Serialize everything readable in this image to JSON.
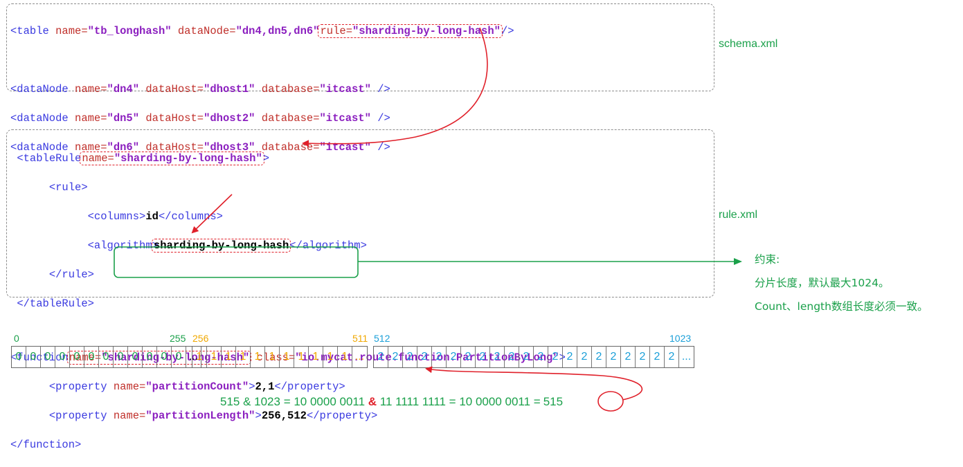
{
  "schema": {
    "table": {
      "tag": "<table",
      "a1": " name=",
      "v1": "\"tb_longhash\"",
      "a2": " dataNode=",
      "v2": "\"dn4,dn5,dn6\"",
      "a3": "rule=",
      "v3": "\"sharding-by-long-hash\"",
      "end": "/>"
    },
    "datanodes": [
      {
        "tag": "<dataNode",
        "a1": " name=",
        "v1": "\"dn4\"",
        "a2": " dataHost=",
        "v2": "\"dhost1\"",
        "a3": " database=",
        "v3": "\"itcast\"",
        "end": " />"
      },
      {
        "tag": "<dataNode",
        "a1": " name=",
        "v1": "\"dn5\"",
        "a2": " dataHost=",
        "v2": "\"dhost2\"",
        "a3": " database=",
        "v3": "\"itcast\"",
        "end": " />"
      },
      {
        "tag": "<dataNode",
        "a1": " name=",
        "v1": "\"dn6\"",
        "a2": " dataHost=",
        "v2": "\"dhost3\"",
        "a3": " database=",
        "v3": "\"itcast\"",
        "end": " />"
      }
    ],
    "file_label": "schema.xml"
  },
  "rule": {
    "tableRule_open": "<tableRule",
    "tableRule_attr": "name=",
    "tableRule_val": "\"sharding-by-long-hash\"",
    "tableRule_gt": ">",
    "rule_open": "<rule>",
    "columns_open": "<columns>",
    "columns_val": "id",
    "columns_close": "</columns>",
    "algorithm_open": "<algorithm>",
    "algorithm_val": "sharding-by-long-hash",
    "algorithm_close": "</algorithm>",
    "rule_close": "</rule>",
    "tableRule_close": "</tableRule>",
    "function_open": "<function",
    "function_attr": "name=",
    "function_val": "\"sharding-by-long-hash\"",
    "function_class_attr": " class=",
    "function_class_val": "\"io.mycat.route.function.PartitionByLong\"",
    "function_gt": ">",
    "prop1_open": "<property",
    "prop1_attr": "name=",
    "prop1_val": "\"partitionCount\"",
    "prop1_gt": ">",
    "prop1_text": "2,1",
    "prop1_close": "</property>",
    "prop2_open": "<property",
    "prop2_attr": "name=",
    "prop2_val": "\"partitionLength\"",
    "prop2_gt": ">",
    "prop2_text": "256,512",
    "prop2_close": "</property>",
    "function_close": "</function>",
    "file_label": "rule.xml"
  },
  "constraints": {
    "title": "约束:",
    "line1": "分片长度，默认最大1024。",
    "line2": "Count、length数组长度必须一致。"
  },
  "partitions": {
    "labels": {
      "l0": "0",
      "l255": "255",
      "l256": "256",
      "l511": "511",
      "l512": "512",
      "l1023": "1023"
    },
    "group1": [
      "0",
      "0",
      "0",
      "0",
      "0",
      "0",
      "0",
      "0",
      "0",
      "0",
      "0",
      "0",
      "..."
    ],
    "group2": [
      "1",
      "1",
      "1",
      "1",
      "1",
      "1",
      "1",
      "1",
      "1",
      "1",
      "1",
      "..."
    ],
    "group3": [
      "2",
      "2",
      "2",
      "2",
      "2",
      "2",
      "2",
      "2",
      "2",
      "2",
      "2",
      "2",
      "2",
      "2",
      "2",
      "2",
      "2",
      "2",
      "2",
      "2",
      "2",
      "..."
    ]
  },
  "formula": {
    "part1": "515 & 1023 = 10 0000 0011 ",
    "amp": "&",
    "part2": " 11 1111 1111 = 10 0000 0011 =",
    "result": "515"
  },
  "colors": {
    "green": "#1aa04a",
    "orange": "#f0a800",
    "blue": "#1a9fd8",
    "red": "#e0202a",
    "black": "#000000"
  }
}
